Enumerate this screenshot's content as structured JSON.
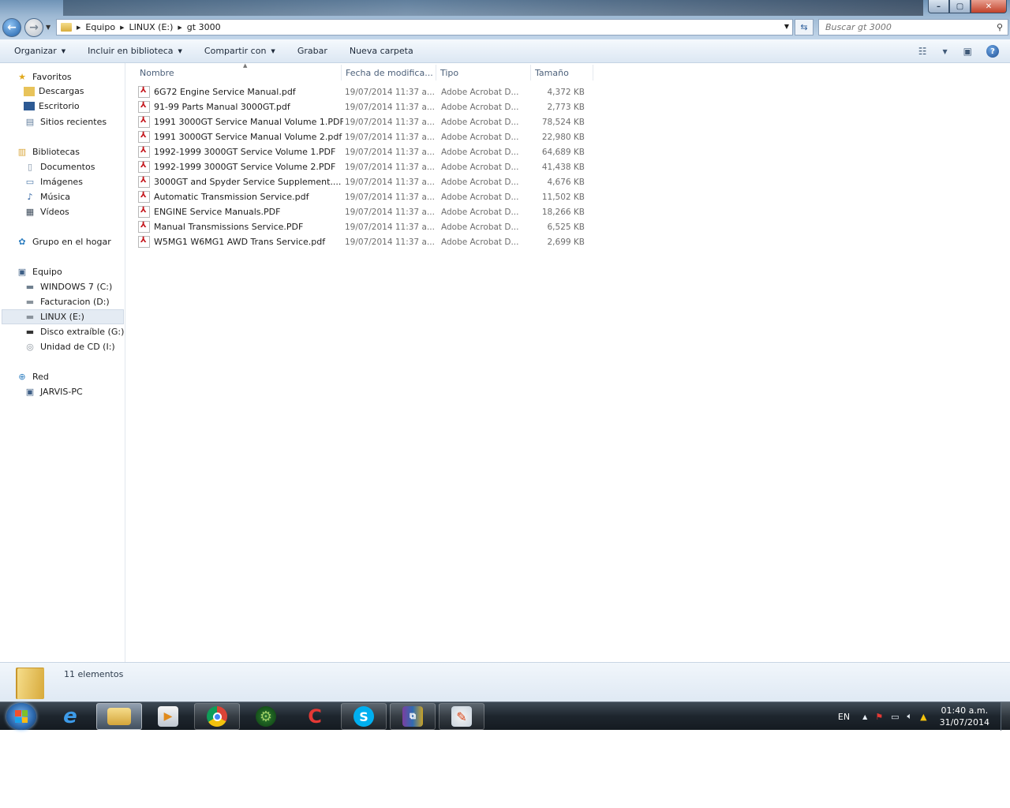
{
  "window": {
    "controls": {
      "minimize": "–",
      "maximize": "▢",
      "close": "✕"
    }
  },
  "address": {
    "crumbs": [
      "Equipo",
      "LINUX (E:)",
      "gt 3000"
    ]
  },
  "search": {
    "placeholder": "Buscar gt 3000"
  },
  "toolbar": {
    "organize": "Organizar",
    "include_library": "Incluir en biblioteca",
    "share_with": "Compartir con",
    "burn": "Grabar",
    "new_folder": "Nueva carpeta",
    "help": "?"
  },
  "nav": {
    "favorites": {
      "label": "Favoritos",
      "items": [
        "Descargas",
        "Escritorio",
        "Sitios recientes"
      ]
    },
    "libraries": {
      "label": "Bibliotecas",
      "items": [
        "Documentos",
        "Imágenes",
        "Música",
        "Vídeos"
      ]
    },
    "homegroup": {
      "label": "Grupo en el hogar"
    },
    "computer": {
      "label": "Equipo",
      "items": [
        "WINDOWS 7 (C:)",
        "Facturacion (D:)",
        "LINUX (E:)",
        "Disco extraíble (G:)",
        "Unidad de CD (I:)"
      ]
    },
    "network": {
      "label": "Red",
      "items": [
        "JARVIS-PC"
      ]
    }
  },
  "columns": {
    "name": "Nombre",
    "date": "Fecha de modifica...",
    "type": "Tipo",
    "size": "Tamaño"
  },
  "files": [
    {
      "name": "6G72 Engine Service Manual.pdf",
      "date": "19/07/2014 11:37 a...",
      "type": "Adobe Acrobat D...",
      "size": "4,372 KB"
    },
    {
      "name": "91-99 Parts Manual 3000GT.pdf",
      "date": "19/07/2014 11:37 a...",
      "type": "Adobe Acrobat D...",
      "size": "2,773 KB"
    },
    {
      "name": "1991 3000GT Service Manual Volume 1.PDF",
      "date": "19/07/2014 11:37 a...",
      "type": "Adobe Acrobat D...",
      "size": "78,524 KB"
    },
    {
      "name": "1991 3000GT Service Manual Volume 2.pdf",
      "date": "19/07/2014 11:37 a...",
      "type": "Adobe Acrobat D...",
      "size": "22,980 KB"
    },
    {
      "name": "1992-1999 3000GT Service Volume 1.PDF",
      "date": "19/07/2014 11:37 a...",
      "type": "Adobe Acrobat D...",
      "size": "64,689 KB"
    },
    {
      "name": "1992-1999 3000GT Service Volume 2.PDF",
      "date": "19/07/2014 11:37 a...",
      "type": "Adobe Acrobat D...",
      "size": "41,438 KB"
    },
    {
      "name": "3000GT and Spyder Service Supplement....",
      "date": "19/07/2014 11:37 a...",
      "type": "Adobe Acrobat D...",
      "size": "4,676 KB"
    },
    {
      "name": "Automatic Transmission Service.pdf",
      "date": "19/07/2014 11:37 a...",
      "type": "Adobe Acrobat D...",
      "size": "11,502 KB"
    },
    {
      "name": "ENGINE Service Manuals.PDF",
      "date": "19/07/2014 11:37 a...",
      "type": "Adobe Acrobat D...",
      "size": "18,266 KB"
    },
    {
      "name": "Manual Transmissions Service.PDF",
      "date": "19/07/2014 11:37 a...",
      "type": "Adobe Acrobat D...",
      "size": "6,525 KB"
    },
    {
      "name": "W5MG1 W6MG1 AWD Trans Service.pdf",
      "date": "19/07/2014 11:37 a...",
      "type": "Adobe Acrobat D...",
      "size": "2,699 KB"
    }
  ],
  "details": {
    "count": "11 elementos"
  },
  "taskbar": {
    "apps": [
      "start-orb",
      "internet-explorer-icon",
      "file-explorer-icon",
      "media-player-icon",
      "chrome-icon",
      "gear-app-icon",
      "ccleaner-icon",
      "skype-icon",
      "winrar-icon",
      "paint-icon"
    ],
    "language": "EN",
    "time": "01:40 a.m.",
    "date": "31/07/2014"
  },
  "colors": {
    "accent": "#2f6cb2",
    "pdf_red": "#c4161c",
    "folder_yellow": "#e8c35a"
  }
}
